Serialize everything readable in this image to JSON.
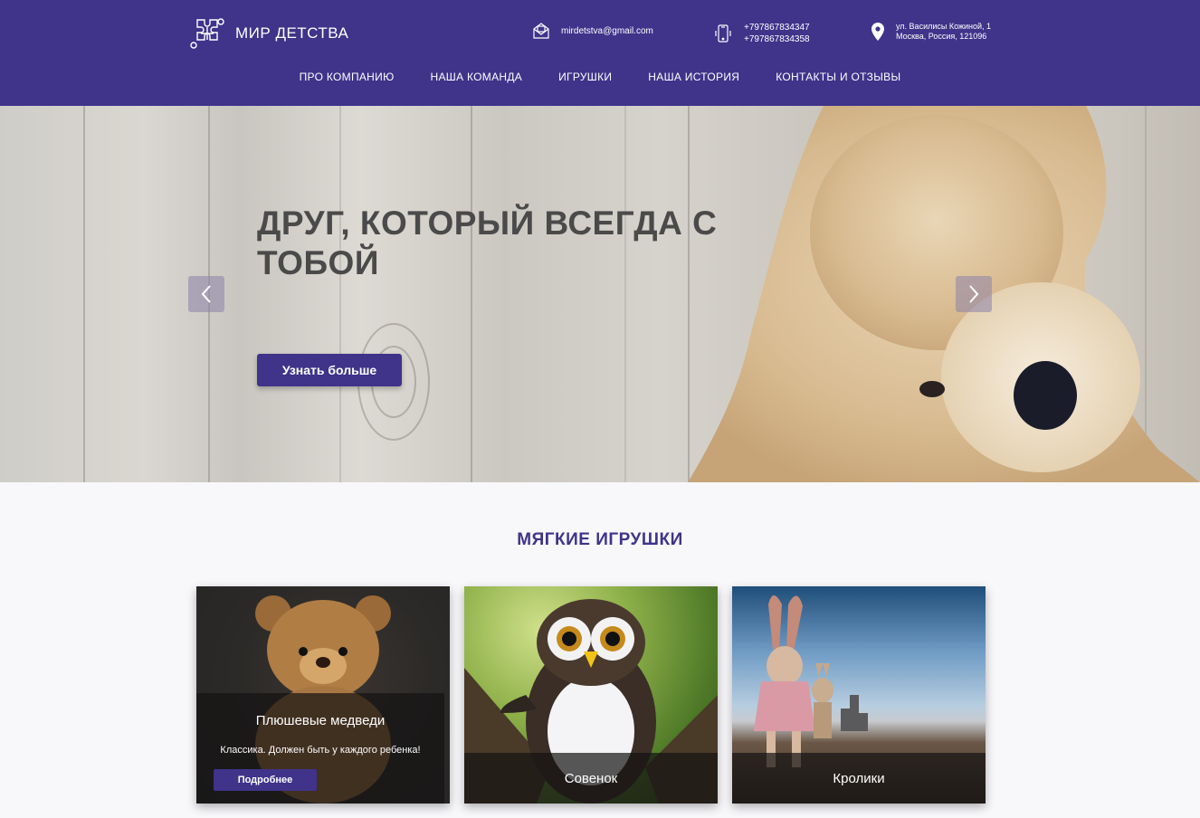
{
  "header": {
    "brand": "МИР ДЕТСТВА",
    "email": "mirdetstva@gmail.com",
    "phones": [
      "+797867834347",
      "+797867834358"
    ],
    "address_line1": "ул. Василисы Кожиной, 1",
    "address_line2": "Москва, Россия, 121096",
    "bg_color": "#3f338a",
    "icons": {
      "logo": "puzzle-logo-icon",
      "email": "envelope-icon",
      "phone": "mobile-phone-icon",
      "address": "map-pin-icon"
    }
  },
  "nav": {
    "items": [
      "ПРО КОМПАНИЮ",
      "НАША КОМАНДА",
      "ИГРУШКИ",
      "НАША ИСТОРИЯ",
      "КОНТАКТЫ И ОТЗЫВЫ"
    ]
  },
  "hero": {
    "title_line1": "ДРУГ, КОТОРЫЙ ВСЕГДА С",
    "title_line2": "ТОБОЙ",
    "button_label": "Узнать больше",
    "prev_icon": "chevron-left-icon",
    "next_icon": "chevron-right-icon"
  },
  "soft_toys": {
    "title": "МЯГКИЕ ИГРУШКИ",
    "cards": [
      {
        "title": "Плюшевые медведи",
        "description": "Классика. Должен быть у каждого ребенка!",
        "button_label": "Подробнее"
      },
      {
        "title": "Совенок"
      },
      {
        "title": "Кролики"
      }
    ]
  }
}
